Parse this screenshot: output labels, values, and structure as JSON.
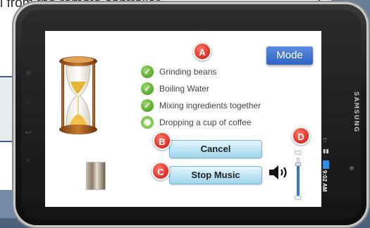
{
  "background": {
    "slide_text": "l from the remote controller"
  },
  "device": {
    "brand": "SAMSUNG",
    "side_buttons": [
      "≡",
      "⌂",
      "↩",
      "⌕"
    ],
    "status": {
      "time": "9:02 AM"
    }
  },
  "app": {
    "mode_button": "Mode",
    "steps": [
      {
        "label": "Grinding beans",
        "state": "done"
      },
      {
        "label": "Boiling Water",
        "state": "done"
      },
      {
        "label": "Mixing ingredients together",
        "state": "done"
      },
      {
        "label": "Dropping a cup of coffee",
        "state": "in-progress"
      }
    ],
    "cancel_button": "Cancel",
    "stop_music_button": "Stop Music",
    "volume_level": 0.82,
    "callouts": {
      "a": "A",
      "b": "B",
      "c": "C",
      "d": "D"
    }
  },
  "colors": {
    "accent_blue": "#2f64c3",
    "badge_red": "#e2362a",
    "check_green": "#55a92b",
    "action_button": "#bfe6f5"
  },
  "icons": [
    "hourglass-icon",
    "check-icon",
    "speaker-icon",
    "wifi-icon",
    "signal-icon",
    "battery-icon"
  ]
}
